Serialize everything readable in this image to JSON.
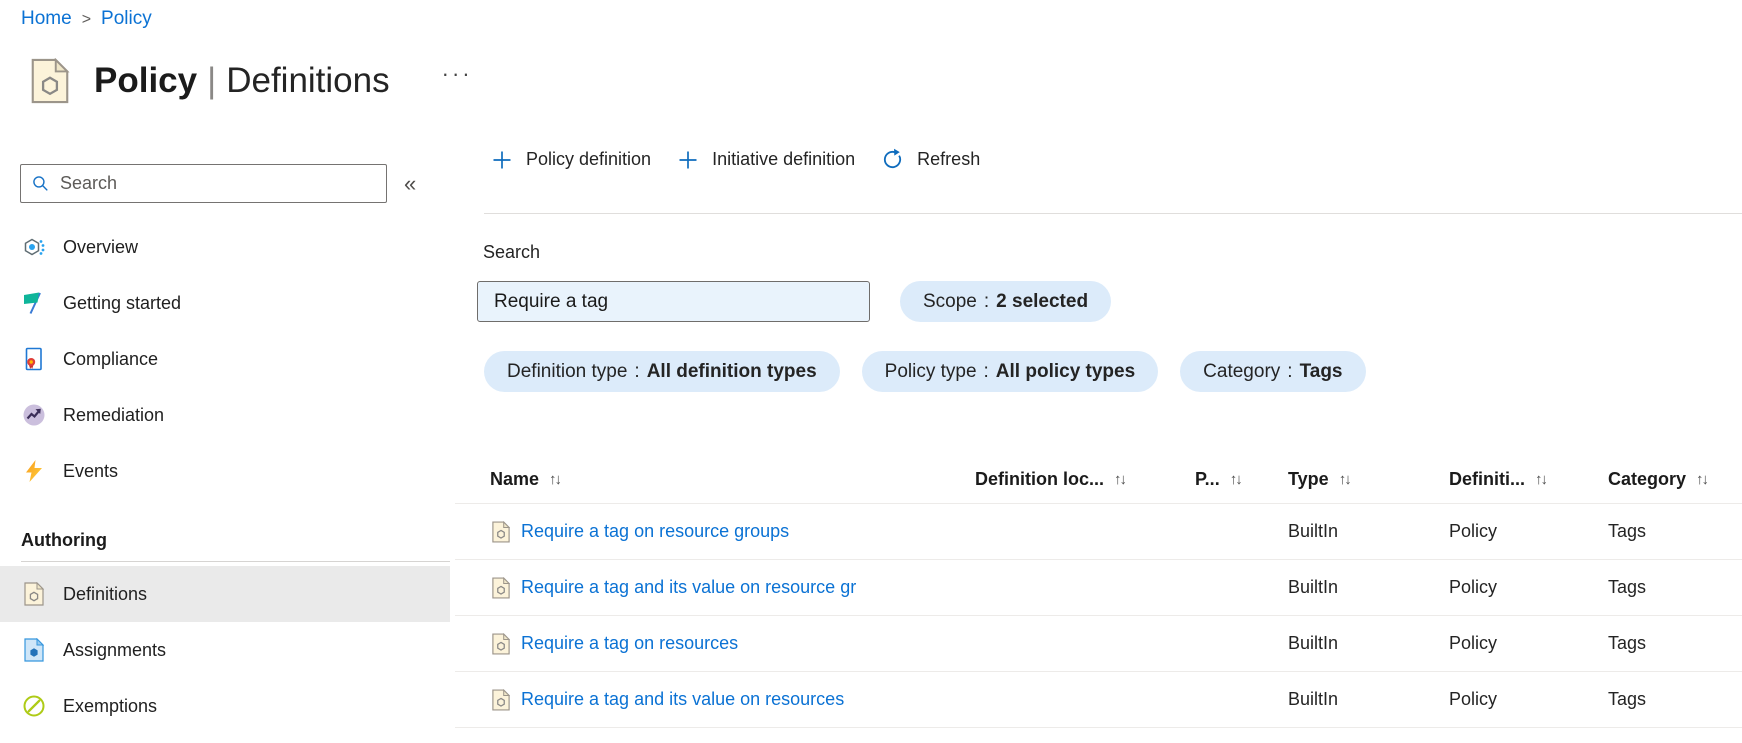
{
  "breadcrumb": {
    "separator": ">",
    "items": [
      {
        "label": "Home"
      },
      {
        "label": "Policy"
      }
    ]
  },
  "page": {
    "icon": "policy-document-icon",
    "title_primary": "Policy",
    "title_separator": "|",
    "title_secondary": "Definitions",
    "more_glyph": "···"
  },
  "sidebar": {
    "search_placeholder": "Search",
    "collapse_glyph": "«",
    "items": [
      {
        "label": "Overview",
        "icon": "overview-icon"
      },
      {
        "label": "Getting started",
        "icon": "getting-started-icon"
      },
      {
        "label": "Compliance",
        "icon": "compliance-icon"
      },
      {
        "label": "Remediation",
        "icon": "remediation-icon"
      },
      {
        "label": "Events",
        "icon": "events-icon"
      }
    ],
    "section": {
      "label": "Authoring"
    },
    "authoring_items": [
      {
        "label": "Definitions",
        "icon": "definitions-icon",
        "selected": true
      },
      {
        "label": "Assignments",
        "icon": "assignments-icon",
        "selected": false
      },
      {
        "label": "Exemptions",
        "icon": "exemptions-icon",
        "selected": false
      }
    ]
  },
  "toolbar": {
    "buttons": [
      {
        "label": "Policy definition",
        "icon": "plus-icon"
      },
      {
        "label": "Initiative definition",
        "icon": "plus-icon"
      },
      {
        "label": "Refresh",
        "icon": "refresh-icon"
      }
    ]
  },
  "filters": {
    "search_label": "Search",
    "search_value": "Require a tag",
    "pill_separator": ":",
    "scope_pill": {
      "label": "Scope",
      "value": "2 selected"
    },
    "pills": [
      {
        "label": "Definition type",
        "value": "All definition types"
      },
      {
        "label": "Policy type",
        "value": "All policy types"
      },
      {
        "label": "Category",
        "value": "Tags"
      }
    ]
  },
  "table": {
    "sort_glyph": "↑↓",
    "row_icon": "policy-definition-icon",
    "columns": [
      {
        "label": "Name"
      },
      {
        "label": "Definition loc..."
      },
      {
        "label": "P..."
      },
      {
        "label": "Type"
      },
      {
        "label": "Definiti..."
      },
      {
        "label": "Category"
      }
    ],
    "rows": [
      {
        "name": "Require a tag on resource groups",
        "definition_location": "",
        "policies": "",
        "type": "BuiltIn",
        "definition_type": "Policy",
        "category": "Tags"
      },
      {
        "name": "Require a tag and its value on resource gr",
        "definition_location": "",
        "policies": "",
        "type": "BuiltIn",
        "definition_type": "Policy",
        "category": "Tags"
      },
      {
        "name": "Require a tag on resources",
        "definition_location": "",
        "policies": "",
        "type": "BuiltIn",
        "definition_type": "Policy",
        "category": "Tags"
      },
      {
        "name": "Require a tag and its value on resources",
        "definition_location": "",
        "policies": "",
        "type": "BuiltIn",
        "definition_type": "Policy",
        "category": "Tags"
      }
    ]
  },
  "colors": {
    "accent": "#0078d4",
    "link": "#0b72d4",
    "pill_background": "#dcebfa",
    "search_input_background": "#e9f3fc",
    "selected_item_background": "#eaeaea",
    "row_divider": "#edebe9",
    "text_primary": "#242424",
    "text_secondary": "#605e5c"
  }
}
